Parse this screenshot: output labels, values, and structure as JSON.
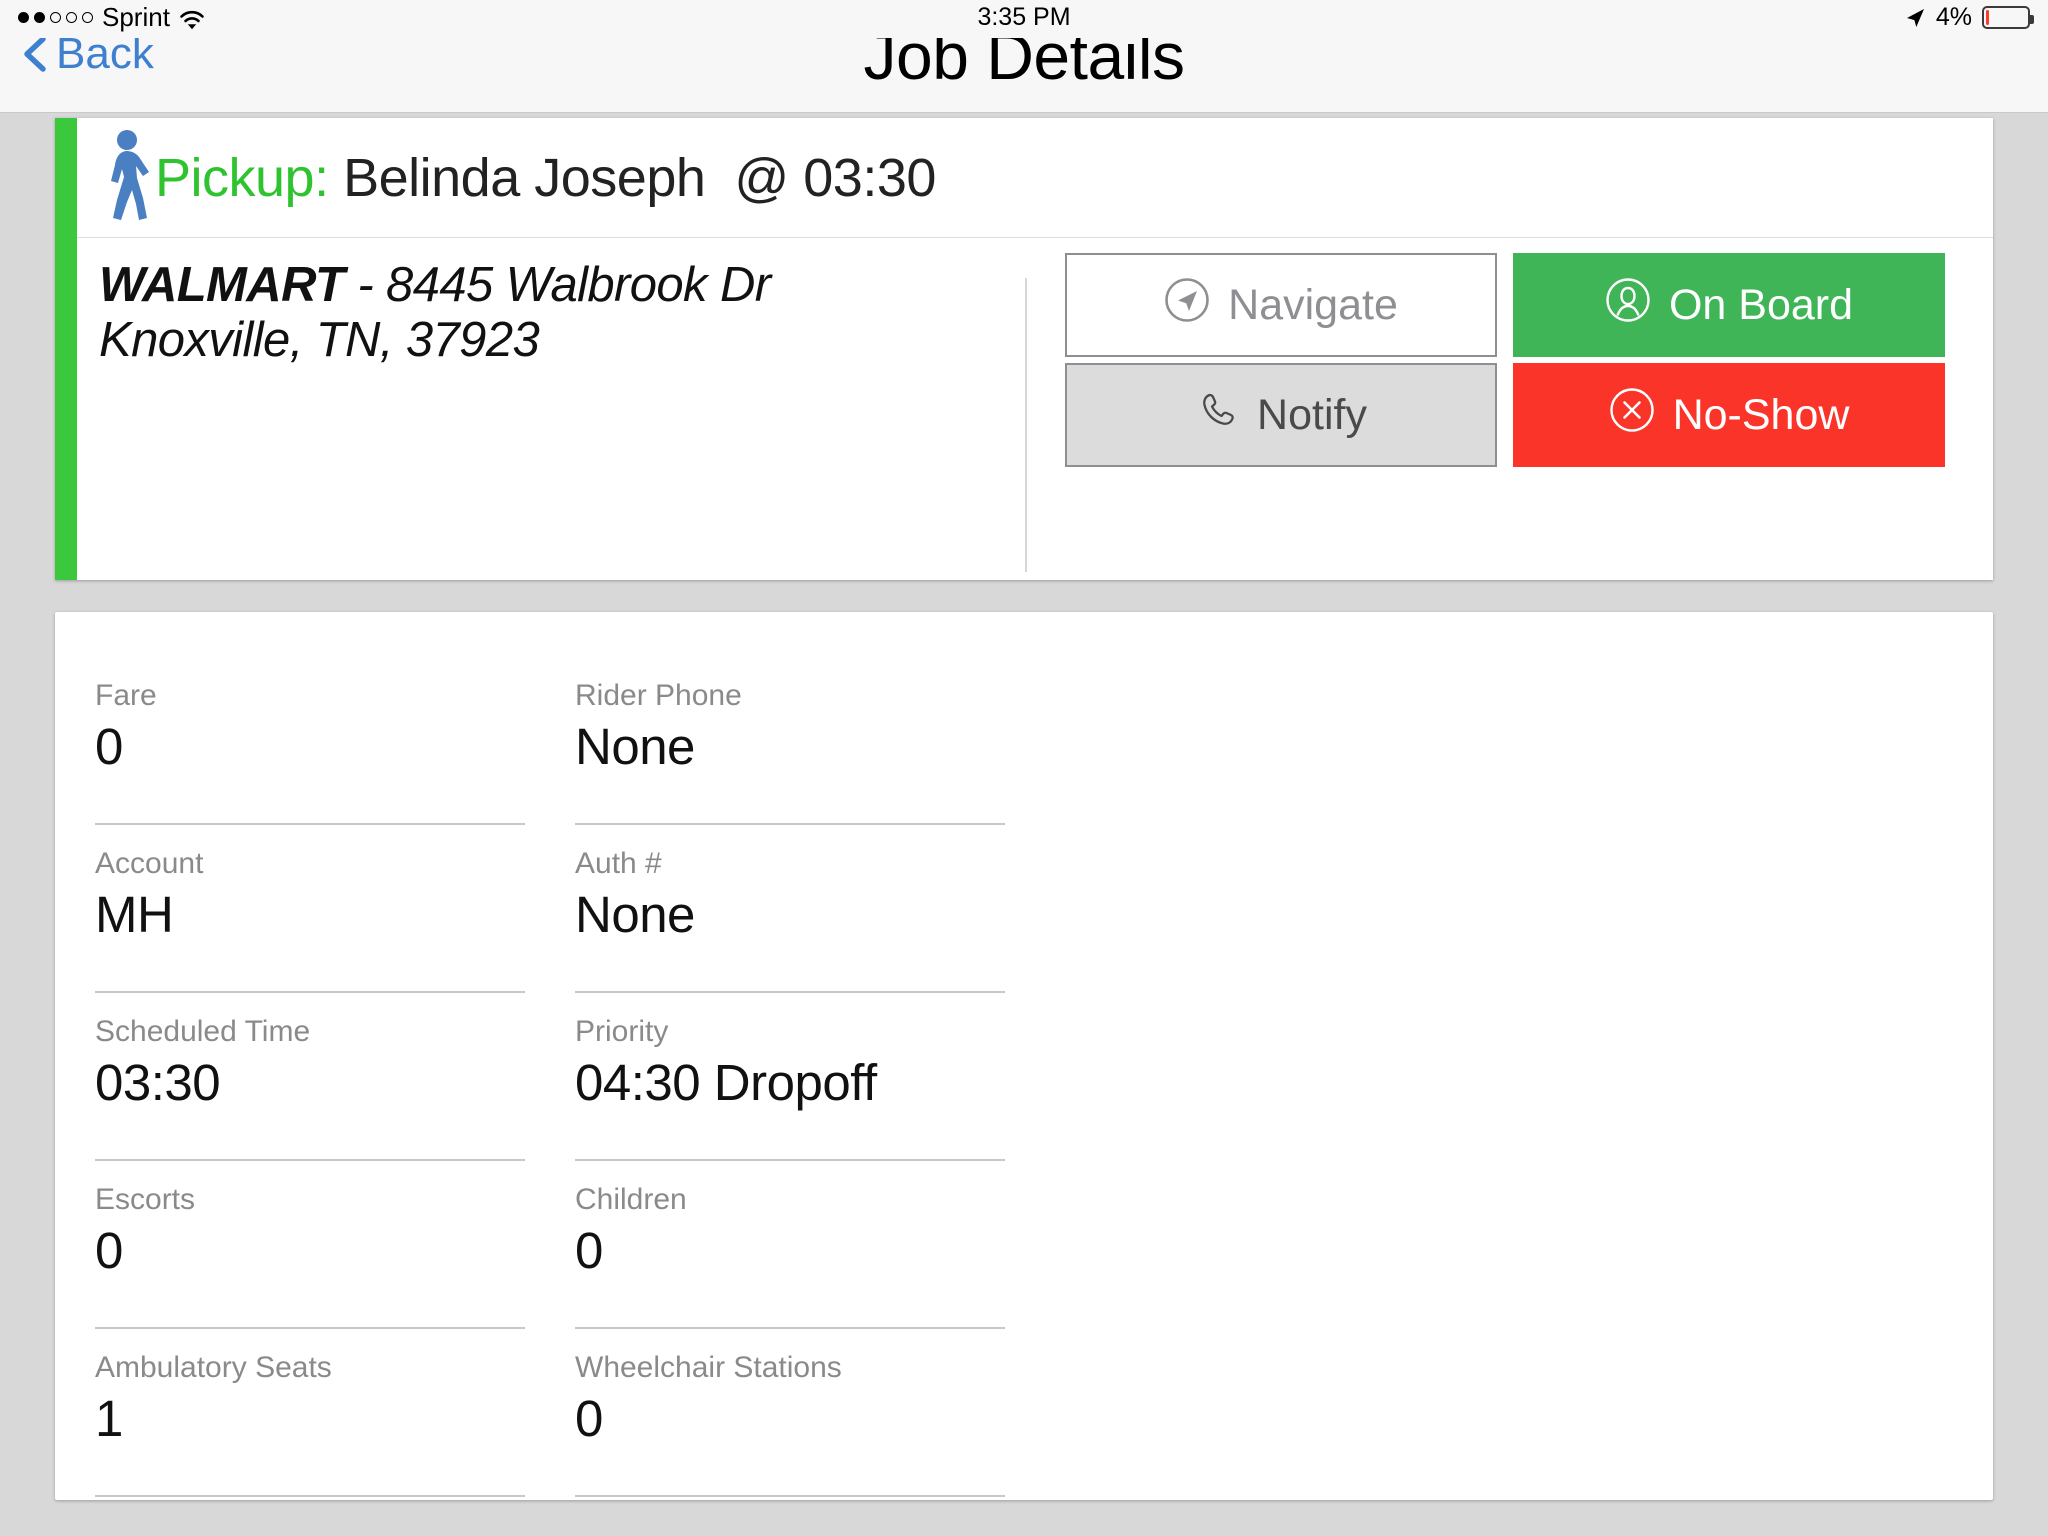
{
  "status_bar": {
    "signal_dots_total": 5,
    "signal_dots_filled": 2,
    "carrier": "Sprint",
    "wifi_icon": "wifi-icon",
    "time": "3:35 PM",
    "location_icon": "location-arrow-icon",
    "battery_percent": "4%",
    "battery_level": 4,
    "battery_color": "#ff3b30"
  },
  "nav": {
    "back_label": "Back",
    "back_icon": "chevron-left-icon",
    "title": "Job Details",
    "tint_color": "#3f7fd0"
  },
  "job_card": {
    "accent_color": "#3cc83c",
    "walker_icon": "pedestrian-icon",
    "pickup_label": "Pickup:",
    "pickup_label_color": "#2fc32f",
    "rider_name": "Belinda Joseph",
    "at_separator": "@",
    "pickup_time": "03:30",
    "address_line1_business": "WALMART",
    "address_line1_rest": " - 8445 Walbrook Dr",
    "address_line2": "Knoxville, TN, 37923",
    "buttons": {
      "navigate": {
        "label": "Navigate",
        "icon": "navigate-arrow-circle-icon",
        "bg": "#ffffff",
        "fg": "#8e8e93"
      },
      "on_board": {
        "label": "On Board",
        "icon": "person-circle-icon",
        "bg": "#3fb558",
        "fg": "#ffffff"
      },
      "notify": {
        "label": "Notify",
        "icon": "phone-handset-icon",
        "bg": "#dcdcdc",
        "fg": "#4a4a4a"
      },
      "no_show": {
        "label": "No-Show",
        "icon": "x-circle-icon",
        "bg": "#fb342a",
        "fg": "#ffffff"
      }
    }
  },
  "details": {
    "rows": [
      [
        {
          "label": "Fare",
          "value": "0"
        },
        {
          "label": "Rider Phone",
          "value": "None"
        }
      ],
      [
        {
          "label": "Account",
          "value": "MH"
        },
        {
          "label": "Auth #",
          "value": "None"
        }
      ],
      [
        {
          "label": "Scheduled Time",
          "value": "03:30"
        },
        {
          "label": "Priority",
          "value": "04:30 Dropoff"
        }
      ],
      [
        {
          "label": "Escorts",
          "value": "0"
        },
        {
          "label": "Children",
          "value": "0"
        }
      ],
      [
        {
          "label": "Ambulatory Seats",
          "value": "1"
        },
        {
          "label": "Wheelchair Stations",
          "value": "0"
        }
      ]
    ]
  }
}
